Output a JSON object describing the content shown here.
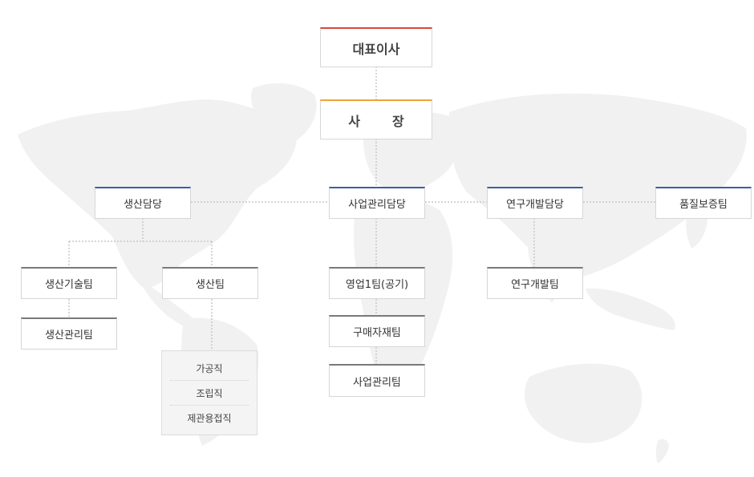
{
  "ceo": "대표이사",
  "president": "사장",
  "departments": {
    "production": "생산담당",
    "business": "사업관리담당",
    "rnd": "연구개발담당",
    "quality": "품질보증팀"
  },
  "teams": {
    "production_tech": "생산기술팀",
    "production_mgmt": "생산관리팀",
    "production": "생산팀",
    "sales1": "영업1팀(공기)",
    "purchasing": "구매자재팀",
    "business_mgmt": "사업관리팀",
    "rnd": "연구개발팀"
  },
  "production_jobs": [
    "가공직",
    "조립직",
    "제관용접직"
  ]
}
